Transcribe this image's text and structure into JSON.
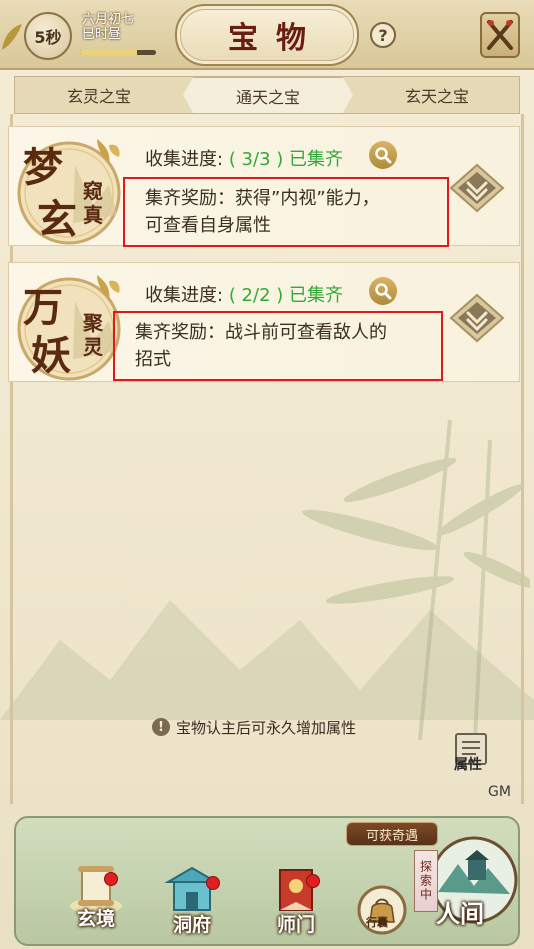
{
  "header": {
    "timer": "5秒",
    "date_line1": "六月初七",
    "date_line2": "巳时昼",
    "date_progress": 0.75,
    "title": "宝物",
    "help_glyph": "?"
  },
  "tabs": [
    {
      "label": "玄灵之宝",
      "active": false
    },
    {
      "label": "通天之宝",
      "active": true
    },
    {
      "label": "玄天之宝",
      "active": false
    }
  ],
  "cards": [
    {
      "medal_big": [
        "梦",
        "玄"
      ],
      "medal_small": "窥真",
      "progress_label": "收集进度:",
      "progress_value": "( 3/3 ) 已集齐",
      "reward_line1": "集齐奖励：获得”内视”能力，",
      "reward_line2": "可查看自身属性"
    },
    {
      "medal_big": [
        "万",
        "妖"
      ],
      "medal_small": "聚灵",
      "progress_label": "收集进度:",
      "progress_value": "( 2/2 ) 已集齐",
      "reward_line1": "集齐奖励：战斗前可查看敌人的",
      "reward_line2": "招式"
    }
  ],
  "notice": {
    "icon_glyph": "!",
    "text": "宝物认主后可永久增加属性"
  },
  "side": {
    "attr_label": "属性",
    "gm_label": "GM"
  },
  "bottom_nav": {
    "items": [
      {
        "label": "玄境",
        "badge": true
      },
      {
        "label": "洞府",
        "badge": true
      },
      {
        "label": "师门",
        "badge": true
      }
    ],
    "bag_label": "行囊",
    "adventure_label": "可获奇遇",
    "explore_label": "探索中",
    "world_label": "人间"
  },
  "colors": {
    "accent_green": "#32a836",
    "highlight_red": "#e31818",
    "title_red": "#6a1e12"
  }
}
